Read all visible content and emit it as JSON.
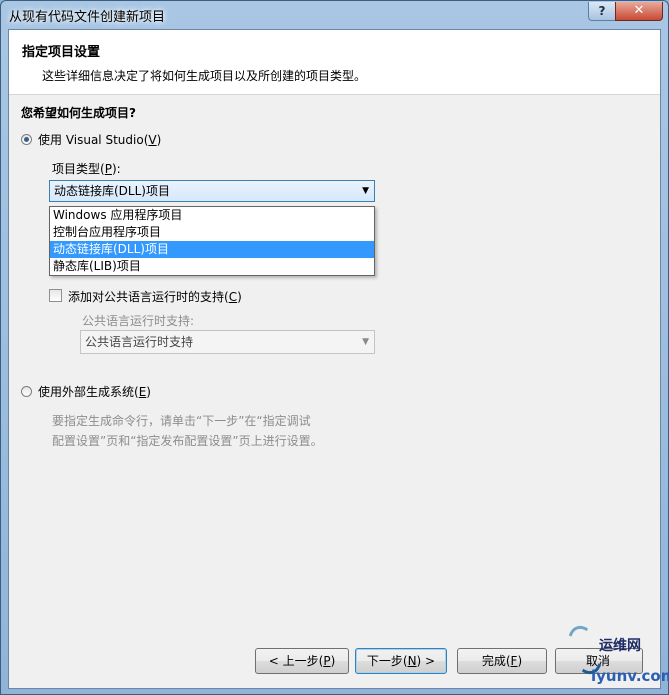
{
  "window": {
    "title": "从现有代码文件创建新项目",
    "help_label": "?",
    "close_label": "✕"
  },
  "header": {
    "title": "指定项目设置",
    "description": "这些详细信息决定了将如何生成项目以及所创建的项目类型。"
  },
  "question": "您希望如何生成项目?",
  "option_vs": {
    "label": "使用 Visual Studio",
    "accel": "V",
    "checked": true
  },
  "project_type": {
    "label": "项目类型",
    "accel": "P",
    "selected": "动态链接库(DLL)项目",
    "options": [
      "Windows 应用程序项目",
      "控制台应用程序项目",
      "动态链接库(DLL)项目",
      "静态库(LIB)项目"
    ]
  },
  "clr_support": {
    "label": "添加对公共语言运行时的支持",
    "accel": "C",
    "checked": false,
    "sub_label": "公共语言运行时支持:",
    "sub_value": "公共语言运行时支持"
  },
  "option_external": {
    "label": "使用外部生成系统",
    "accel": "E",
    "checked": false,
    "description_line1": "要指定生成命令行，请单击“下一步”在“指定调试",
    "description_line2": "配置设置”页和“指定发布配置设置”页上进行设置。"
  },
  "buttons": {
    "back": {
      "pre": "< 上一步(",
      "accel": "P",
      "post": ")"
    },
    "next": {
      "pre": "下一步(",
      "accel": "N",
      "post": ") >"
    },
    "finish": {
      "pre": "完成(",
      "accel": "F",
      "post": ")"
    },
    "cancel": {
      "label": "取消"
    }
  },
  "watermark": {
    "line1": "运维网",
    "line2": "iyunv.com"
  }
}
